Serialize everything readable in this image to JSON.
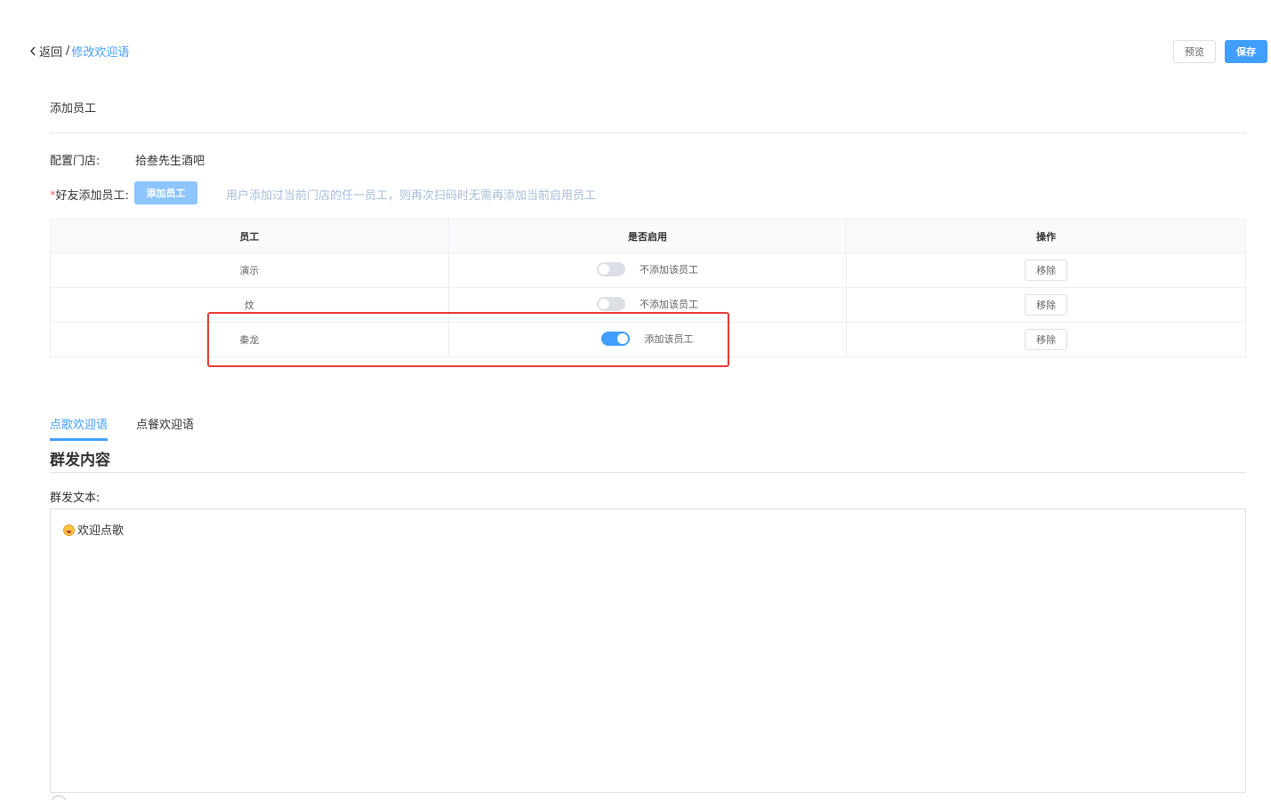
{
  "breadcrumb": {
    "back_label": "返回",
    "separator": "/",
    "current": "修改欢迎语"
  },
  "toolbar": {
    "preview_label": "预览",
    "save_label": "保存"
  },
  "section": {
    "title": "添加员工"
  },
  "store": {
    "label": "配置门店:",
    "value": "拾叁先生酒吧"
  },
  "staff": {
    "required_mark": "*",
    "label": "好友添加员工:",
    "add_button": "添加员工",
    "hint": "用户添加过当前门店的任一员工，则再次扫码时无需再添加当前启用员工"
  },
  "table": {
    "headers": [
      "员工",
      "是否启用",
      "操作"
    ],
    "rows": [
      {
        "name": "演示",
        "enabled": false,
        "status_text": "不添加该员工",
        "action": "移除"
      },
      {
        "name": "炆",
        "enabled": false,
        "status_text": "不添加该员工",
        "action": "移除"
      },
      {
        "name": "秦龙",
        "enabled": true,
        "status_text": "添加该员工",
        "action": "移除"
      }
    ]
  },
  "tabs": [
    {
      "label": "点歌欢迎语",
      "active": true
    },
    {
      "label": "点餐欢迎语",
      "active": false
    }
  ],
  "content": {
    "title": "群发内容",
    "text_label": "群发文本:",
    "text_value": "欢迎点歌",
    "emoji": "grinning-face-emoji"
  },
  "colors": {
    "primary": "#409eff",
    "primary_light": "#8cc5ff",
    "highlight": "#e53935",
    "required": "#f56c6c"
  }
}
